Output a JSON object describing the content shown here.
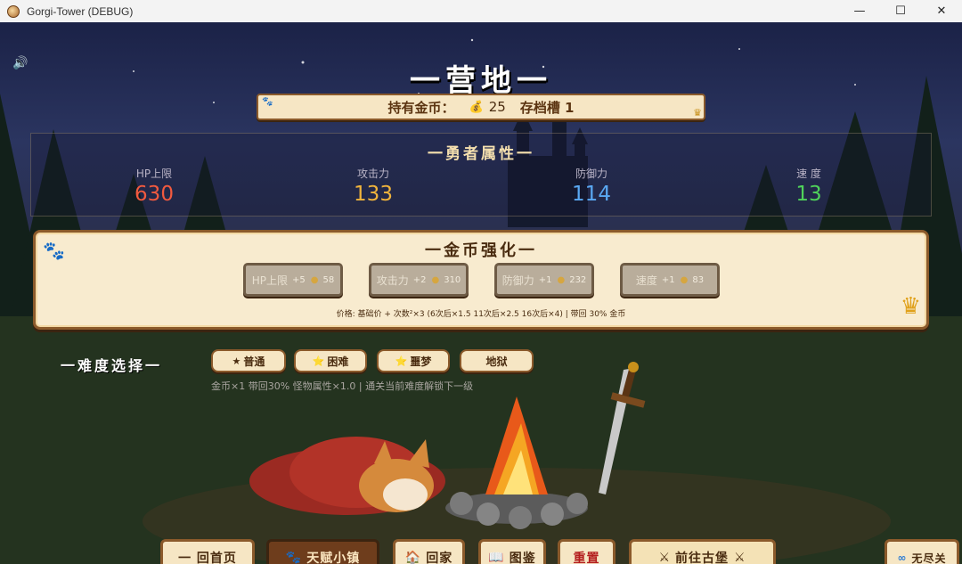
{
  "window": {
    "title": "Gorgi-Tower (DEBUG)",
    "minimize": "—",
    "maximize": "☐",
    "close": "✕"
  },
  "header": {
    "sound_icon": "🔊",
    "title": "一营地一"
  },
  "gold_bar": {
    "label": "持有金币：",
    "coin_icon": "coin-bag-icon",
    "gold": "25",
    "slot": "存档槽 1"
  },
  "hero_stats": {
    "title": "一勇者属性一",
    "items": [
      {
        "label": "HP上限",
        "value": "630",
        "color": "#f25a3f"
      },
      {
        "label": "攻击力",
        "value": "133",
        "color": "#f0b43c"
      },
      {
        "label": "防御力",
        "value": "114",
        "color": "#5aa8f2"
      },
      {
        "label": "速  度",
        "value": "13",
        "color": "#4fd25a"
      }
    ]
  },
  "upgrade": {
    "title": "一金币强化一",
    "buttons": [
      {
        "label": "HP上限",
        "gain": "+5",
        "cost": "58"
      },
      {
        "label": "攻击力",
        "gain": "+2",
        "cost": "310"
      },
      {
        "label": "防御力",
        "gain": "+1",
        "cost": "232"
      },
      {
        "label": "速度",
        "gain": "+1",
        "cost": "83"
      }
    ],
    "price_note": "价格: 基础价 + 次数²×3  (6次后×1.5 11次后×2.5 16次后×4)  |  带回 30% 金币"
  },
  "difficulty": {
    "title": "一难度选择一",
    "options": [
      {
        "label": "普通",
        "icon": "★"
      },
      {
        "label": "困难",
        "icon": "⭐"
      },
      {
        "label": "噩梦",
        "icon": "⭐"
      },
      {
        "label": "地狱",
        "icon": ""
      }
    ],
    "note": "金币×1  带回30%  怪物属性×1.0  |  通关当前难度解锁下一级"
  },
  "bottom_bar": {
    "home": "一 回首页",
    "talent": "天赋小镇",
    "go_home": "回家",
    "codex": "图鉴",
    "reset": "重置",
    "castle": "前往古堡",
    "endless": "无尽关"
  },
  "colors": {
    "panel_bg": "#f8ebcf",
    "panel_border": "#8b5a2b",
    "text_brown": "#4a2c10",
    "accent_gold": "#e0a11b"
  }
}
